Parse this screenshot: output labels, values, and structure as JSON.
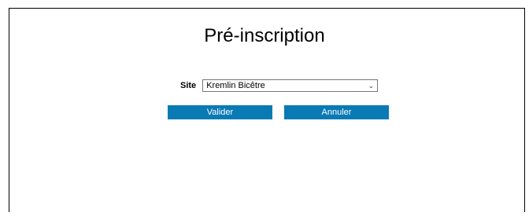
{
  "page": {
    "title": "Pré-inscription"
  },
  "form": {
    "site_label": "Site",
    "site_value": "Kremlin Bicêtre",
    "validate_label": "Valider",
    "cancel_label": "Annuler"
  },
  "colors": {
    "button_bg": "#0a7ab5",
    "button_text": "#ffffff"
  }
}
